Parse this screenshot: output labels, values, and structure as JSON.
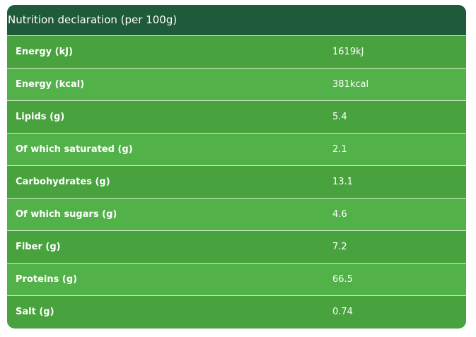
{
  "table": {
    "title": "Nutrition declaration (per 100g)",
    "rows": [
      {
        "label": "Energy (kJ)",
        "value": "1619kJ"
      },
      {
        "label": "Energy (kcal)",
        "value": "381kcal"
      },
      {
        "label": "Lipids (g)",
        "value": "5.4"
      },
      {
        "label": "Of which saturated (g)",
        "value": "2.1"
      },
      {
        "label": "Carbohydrates (g)",
        "value": "13.1"
      },
      {
        "label": "Of which sugars (g)",
        "value": "4.6"
      },
      {
        "label": "Fiber (g)",
        "value": "7.2"
      },
      {
        "label": "Proteins (g)",
        "value": "66.5"
      },
      {
        "label": "Salt (g)",
        "value": "0.74"
      }
    ]
  },
  "colors": {
    "header_bg": "#1f5a3a",
    "row_dark": "#48a23e",
    "row_light": "#52b148",
    "text": "#ffffff"
  }
}
